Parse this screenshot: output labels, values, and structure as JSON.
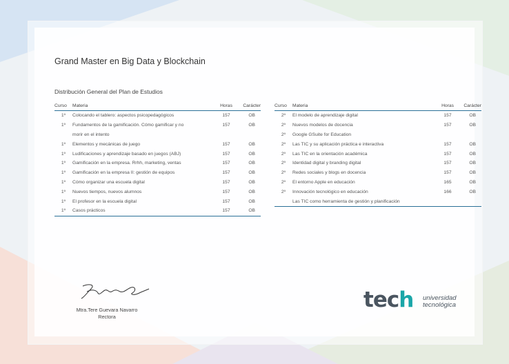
{
  "document": {
    "title": "Grand Master en Big Data y Blockchain",
    "subtitle": "Distribución General del Plan de Estudios"
  },
  "table_headers": {
    "curso": "Curso",
    "materia": "Materia",
    "horas": "Horas",
    "caracter": "Carácter"
  },
  "left_table": [
    {
      "curso": "1º",
      "materia": "Colocando el tablero: aspectos psicopedagógicos",
      "horas": "157",
      "caracter": "OB"
    },
    {
      "curso": "1º",
      "materia": "Fundamentos de la gamificación. Cómo gamificar y no",
      "horas": "157",
      "caracter": "OB"
    },
    {
      "curso": "",
      "materia": "morir en el intento",
      "horas": "",
      "caracter": ""
    },
    {
      "curso": "1º",
      "materia": "Elementos y mecánicas de juego",
      "horas": "157",
      "caracter": "OB"
    },
    {
      "curso": "1º",
      "materia": "Ludificaciones y aprendizaje basado en juegos (ABJ)",
      "horas": "157",
      "caracter": "OB"
    },
    {
      "curso": "1º",
      "materia": "Gamificación en la empresa. Rrhh, marketing, ventas",
      "horas": "157",
      "caracter": "OB"
    },
    {
      "curso": "1º",
      "materia": "Gamificación en la empresa II: gestión de equipos",
      "horas": "157",
      "caracter": "OB"
    },
    {
      "curso": "1º",
      "materia": "Cómo organizar una escuela digital",
      "horas": "157",
      "caracter": "OB"
    },
    {
      "curso": "1º",
      "materia": "Nuevos tiempos, nuevos alumnos",
      "horas": "157",
      "caracter": "OB"
    },
    {
      "curso": "1º",
      "materia": "El profesor en la escuela digital",
      "horas": "157",
      "caracter": "OB"
    },
    {
      "curso": "1º",
      "materia": "Casos prácticos",
      "horas": "157",
      "caracter": "OB"
    }
  ],
  "right_table": [
    {
      "curso": "2º",
      "materia": "El modelo de aprendizaje digital",
      "horas": "157",
      "caracter": "OB"
    },
    {
      "curso": "2º",
      "materia": "Nuevos modelos de docencia",
      "horas": "157",
      "caracter": "OB"
    },
    {
      "curso": "2º",
      "materia": "Google GSuite for Education",
      "horas": "",
      "caracter": ""
    },
    {
      "curso": "2º",
      "materia": "Las TIC y su aplicación práctica e interactiva",
      "horas": "157",
      "caracter": "OB"
    },
    {
      "curso": "2º",
      "materia": "Las TIC en la orientación académica",
      "horas": "157",
      "caracter": "OB"
    },
    {
      "curso": "2º",
      "materia": "Identidad digital y branding digital",
      "horas": "157",
      "caracter": "OB"
    },
    {
      "curso": "2º",
      "materia": "Redes sociales y blogs en docencia",
      "horas": "157",
      "caracter": "OB"
    },
    {
      "curso": "2º",
      "materia": "El entorno Apple en educación",
      "horas": "165",
      "caracter": "OB"
    },
    {
      "curso": "2º",
      "materia": "Innovación tecnológico en educación",
      "horas": "166",
      "caracter": "OB"
    },
    {
      "curso": "",
      "materia": "Las TIC como herramienta de gestión y planificación",
      "horas": "",
      "caracter": ""
    }
  ],
  "signature": {
    "name": "Mtra.Tere Guevara Navarro",
    "role": "Rectora"
  },
  "logo": {
    "word_start": "tec",
    "word_end": "h",
    "line1": "universidad",
    "line2": "tecnológica",
    "accent": "#1aa6a8"
  }
}
